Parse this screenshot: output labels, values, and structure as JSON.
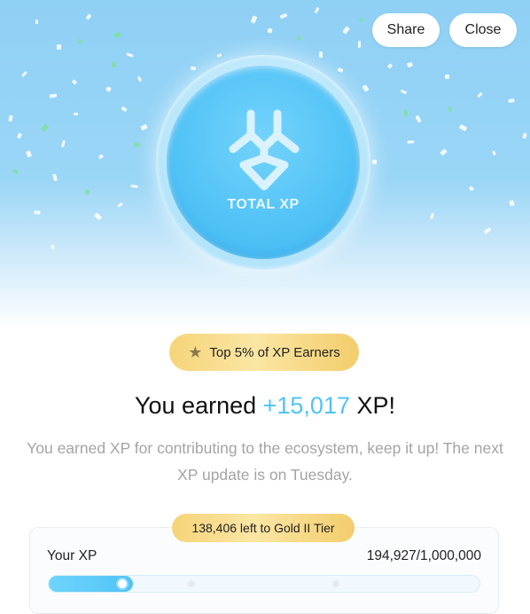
{
  "header": {
    "share_label": "Share",
    "close_label": "Close"
  },
  "coin": {
    "label": "TOTAL XP",
    "icon": "xp-logo-icon"
  },
  "badge": {
    "icon": "star-icon",
    "text": "Top 5% of XP Earners"
  },
  "headline": {
    "prefix": "You earned ",
    "amount": "+15,017",
    "suffix": " XP!"
  },
  "description": "You earned XP for contributing to the ecosystem, keep it up! The next XP update is on Tuesday.",
  "progress": {
    "tier_remaining": "138,406 left to Gold II Tier",
    "label": "Your XP",
    "value": "194,927/1,000,000",
    "fill_fraction": 0.195
  },
  "colors": {
    "accent": "#4fc3f7",
    "gold": "#f6d479",
    "hero_bg": "#8fd0f5"
  }
}
